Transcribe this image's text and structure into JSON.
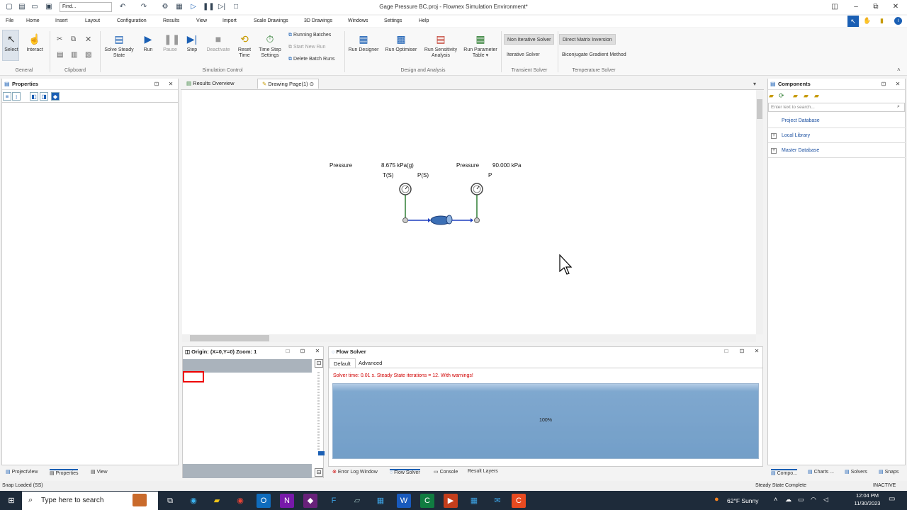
{
  "window": {
    "title": "Gage Pressure BC.proj - Flownex Simulation Environment*",
    "find_placeholder": "Find..."
  },
  "menu": [
    "File",
    "Home",
    "Insert",
    "Layout",
    "Configuration",
    "Results",
    "View",
    "Import",
    "Scale Drawings",
    "3D Drawings",
    "Windows",
    "Settings",
    "Help"
  ],
  "ribbon": {
    "general": {
      "select": "Select",
      "interact": "Interact",
      "label": "General"
    },
    "clipboard": {
      "label": "Clipboard"
    },
    "sim": {
      "solve_line1": "Solve Steady",
      "solve_line2": "State",
      "run": "Run",
      "pause": "Pause",
      "step": "Step",
      "deactivate": "Deactivate",
      "reset_line1": "Reset",
      "reset_line2": "Time",
      "tss_line1": "Time Step",
      "tss_line2": "Settings",
      "running_batches": "Running Batches",
      "start_new_run": "Start New Run",
      "delete_batch": "Delete Batch Runs",
      "label": "Simulation Control"
    },
    "design": {
      "run_designer": "Run Designer",
      "run_optimiser": "Run Optimiser",
      "rsa_line1": "Run Sensitivity",
      "rsa_line2": "Analysis",
      "rpt_line1": "Run Parameter",
      "rpt_line2": "Table",
      "label": "Design and Analysis"
    },
    "transient": {
      "non_iterative": "Non Iterative Solver",
      "iterative": "Iterative Solver",
      "label": "Transient Solver"
    },
    "temperature": {
      "direct_matrix": "Direct Matrix Inversion",
      "biconjugate": "Biconjugate Gradient Method",
      "label": "Temperature Solver"
    }
  },
  "properties": {
    "title": "Properties"
  },
  "tabs": {
    "results_overview": "Results Overview",
    "drawing_page": "Drawing Page(1)"
  },
  "canvas": {
    "left_pressure_label": "Pressure",
    "left_pressure_value": "8.675 kPa(g)",
    "left_t": "T(S)",
    "left_p": "P(S)",
    "right_pressure_label": "Pressure",
    "right_pressure_value": "90.000 kPa",
    "right_p": "P"
  },
  "overview": {
    "title": "Origin: (X=0,Y=0) Zoom: 1"
  },
  "flow_solver": {
    "title": "Flow Solver",
    "tab_default": "Default",
    "tab_advanced": "Advanced",
    "message": "Solver time: 0.01 s. Steady State iterations = 12. With warnings!",
    "progress_label": "100%",
    "progress": 1.0
  },
  "bottom_tabs": {
    "error_log": "Error Log Window",
    "flow_solver": "Flow Solver",
    "console": "Console",
    "result_layers": "Result Layers"
  },
  "left_bottom_tabs": {
    "projectview": "ProjectView",
    "properties": "Properties",
    "view": "View"
  },
  "components": {
    "title": "Components",
    "search_placeholder": "Enter text to search...",
    "items": [
      "Project Database",
      "Local Library",
      "Master Database"
    ]
  },
  "right_bottom_tabs": {
    "components": "Compo...",
    "charts": "Charts ...",
    "solvers": "Solvers",
    "snaps": "Snaps"
  },
  "status": {
    "left": "Snap Loaded (SS)",
    "center": "Steady State Complete",
    "right": "INACTIVE"
  },
  "taskbar": {
    "search": "Type here to search",
    "weather": "62°F  Sunny",
    "time": "12:04 PM",
    "date": "11/30/2023"
  },
  "colors": {
    "accent": "#1a5fb4",
    "pipe": "#1e3fbf",
    "link": "#2e7d32",
    "error": "#d00000",
    "progress": "#7fa8cf"
  }
}
